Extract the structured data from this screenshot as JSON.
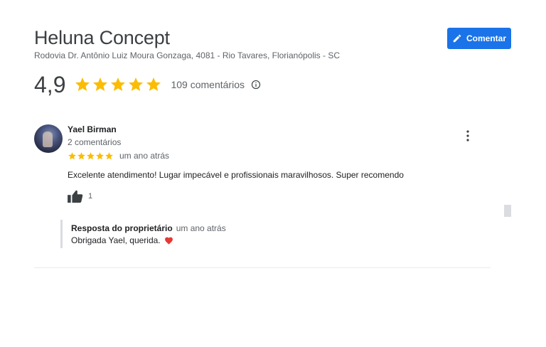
{
  "place": {
    "title": "Heluna Concept",
    "address": "Rodovia Dr. Antônio Luiz Moura Gonzaga, 4081 - Rio Tavares, Florianópolis - SC"
  },
  "header": {
    "comment_button_label": "Comentar",
    "comment_icon": "pencil-icon"
  },
  "rating": {
    "value": "4,9",
    "stars": 5,
    "count_label": "109 comentários",
    "info_icon": "info-icon"
  },
  "review": {
    "reviewer_name": "Yael Birman",
    "reviewer_meta": "2 comentários",
    "stars": 5,
    "time": "um ano atrás",
    "text": "Excelente atendimento! Lugar impecável e profissionais maravilhosos. Super recomendo",
    "likes": "1",
    "like_icon": "thumbs-up-icon",
    "menu_icon": "more-vert-icon"
  },
  "owner_reply": {
    "label": "Resposta do proprietário",
    "time": "um ano atrás",
    "text": "Obrigada Yael, querida.",
    "emoji_icon": "heart-icon"
  },
  "colors": {
    "accent": "#1a73e8",
    "star": "#fbbc04",
    "heart": "#e53935",
    "muted_text": "#5f6368"
  }
}
